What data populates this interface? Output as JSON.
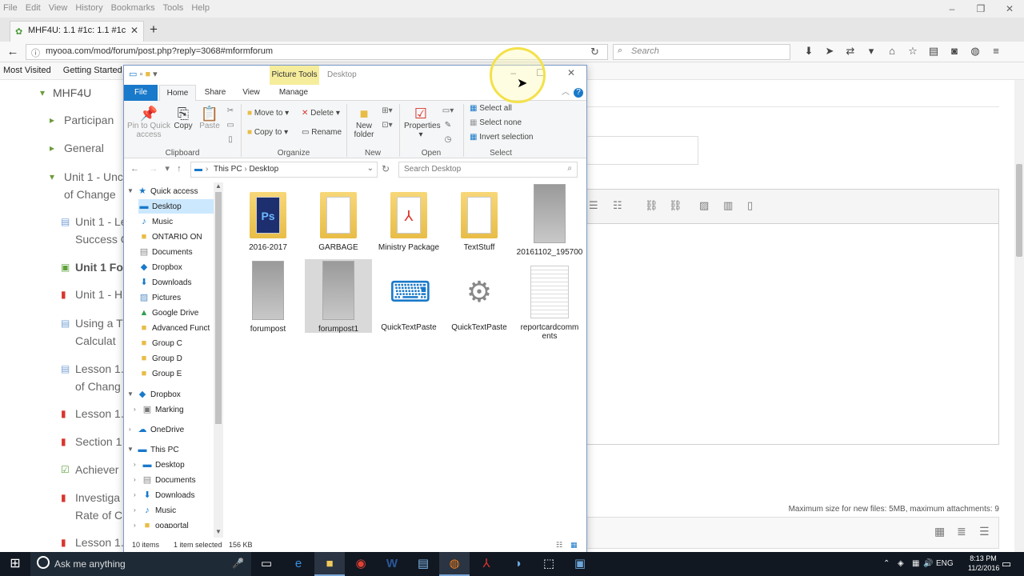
{
  "firefox": {
    "menu": [
      "File",
      "Edit",
      "View",
      "History",
      "Bookmarks",
      "Tools",
      "Help"
    ],
    "tab_title": "MHF4U: 1.1 #1c: 1.1 #1c",
    "url": "myooa.com/mod/forum/post.php?reply=3068#mformforum",
    "search_placeholder": "Search",
    "bookmarks": [
      "Most Visited",
      "Getting Started"
    ]
  },
  "course_nav": {
    "course": "MHF4U",
    "items": [
      {
        "label": "Participan",
        "type": "caret"
      },
      {
        "label": "General",
        "type": "caret"
      },
      {
        "label": "Unit 1 - Unc",
        "label2": "of Change",
        "type": "caret-open"
      },
      {
        "label": "Unit 1 - Le",
        "label2": "Success C",
        "type": "page"
      },
      {
        "label": "Unit 1 For",
        "type": "forum"
      },
      {
        "label": "Unit 1 - H",
        "type": "pdf"
      },
      {
        "label": "Using a T",
        "label2": "Calculat",
        "type": "page"
      },
      {
        "label": "Lesson 1.",
        "label2": "of Chang",
        "type": "page"
      },
      {
        "label": "Lesson 1.",
        "type": "pdf"
      },
      {
        "label": "Section 1",
        "type": "pdf"
      },
      {
        "label": "Achiever",
        "type": "check"
      },
      {
        "label": "Investiga",
        "label2": "Rate of C",
        "type": "pdf"
      },
      {
        "label": "Lesson 1.",
        "type": "pdf"
      }
    ]
  },
  "editor": {
    "file_limit": "Maximum size for new files: 5MB, maximum attachments: 9"
  },
  "explorer": {
    "context_tab": "Picture Tools",
    "window_name": "Desktop",
    "ribbon_tabs": [
      "File",
      "Home",
      "Share",
      "View",
      "Manage"
    ],
    "clipboard": {
      "pin": "Pin to Quick",
      "pin2": "access",
      "copy": "Copy",
      "paste": "Paste",
      "group": "Clipboard"
    },
    "organize": {
      "move_to": "Move to",
      "copy_to": "Copy to",
      "delete": "Delete",
      "rename": "Rename",
      "group": "Organize"
    },
    "new": {
      "new_folder": "New",
      "new_folder2": "folder",
      "group": "New"
    },
    "open": {
      "properties": "Properties",
      "group": "Open"
    },
    "select": {
      "all": "Select all",
      "none": "Select none",
      "invert": "Invert selection",
      "group": "Select"
    },
    "breadcrumb": [
      "This PC",
      "Desktop"
    ],
    "search_placeholder": "Search Desktop",
    "tree": {
      "quick_access": "Quick access",
      "qa_items": [
        "Desktop",
        "Music",
        "ONTARIO ON",
        "Documents",
        "Dropbox",
        "Downloads",
        "Pictures",
        "Google Drive",
        "Advanced Funct",
        "Group C",
        "Group D",
        "Group E"
      ],
      "dropbox": "Dropbox",
      "marking": "Marking",
      "onedrive": "OneDrive",
      "this_pc": "This PC",
      "pc_items": [
        "Desktop",
        "Documents",
        "Downloads",
        "Music",
        "ooaportal"
      ]
    },
    "files": [
      {
        "name": "2016-2017",
        "kind": "folder"
      },
      {
        "name": "GARBAGE",
        "kind": "folder"
      },
      {
        "name": "Ministry Package",
        "kind": "folder"
      },
      {
        "name": "TextStuff",
        "kind": "folder"
      },
      {
        "name": "20161102_195700",
        "kind": "photo"
      },
      {
        "name": "forumpost",
        "kind": "photo"
      },
      {
        "name": "forumpost1",
        "kind": "photo"
      },
      {
        "name": "QuickTextPaste",
        "kind": "app"
      },
      {
        "name": "QuickTextPaste",
        "kind": "settings"
      },
      {
        "name": "reportcardcomm",
        "name2": "ents",
        "kind": "doc"
      }
    ],
    "status_items": "10 items",
    "status_selected": "1 item selected",
    "status_size": "156 KB"
  },
  "taskbar": {
    "search": "Ask me anything",
    "lang": "ENG",
    "time": "8:13 PM",
    "date": "11/2/2016"
  },
  "colors": {
    "accent": "#1979ca",
    "folder": "#f0c95c",
    "taskbar": "#111822"
  }
}
